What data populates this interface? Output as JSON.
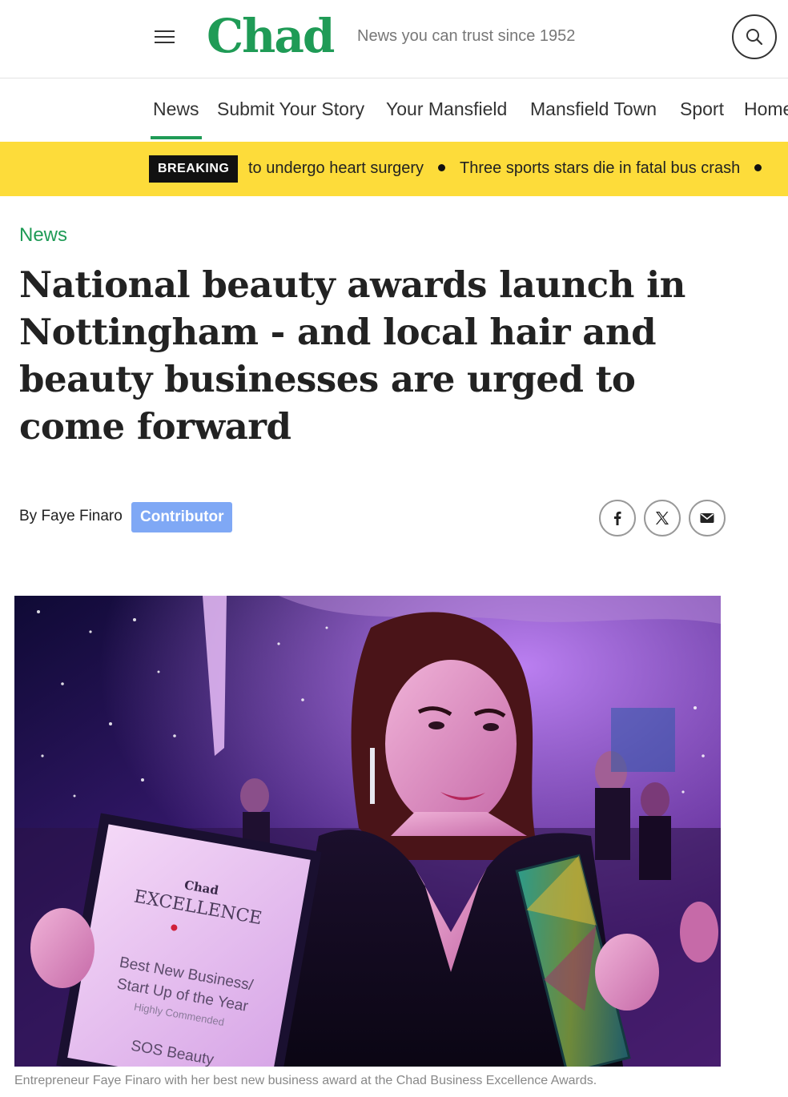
{
  "header": {
    "logo": "Chad",
    "tagline": "News you can trust since 1952"
  },
  "nav": {
    "items": [
      {
        "label": "News"
      },
      {
        "label": "Submit Your Story"
      },
      {
        "label": "Your Mansfield"
      },
      {
        "label": "Mansfield Town"
      },
      {
        "label": "Sport"
      },
      {
        "label": "Home"
      }
    ]
  },
  "breaking": {
    "badge": "BREAKING",
    "items": [
      "to undergo heart surgery",
      "Three sports stars die in fatal bus crash"
    ]
  },
  "article": {
    "section": "News",
    "headline": "National beauty awards launch in Nottingham - and local hair and beauty businesses are urged to come forward",
    "byline_prefix": "By ",
    "author": "Faye Finaro",
    "author_badge": "Contributor",
    "caption": "Entrepreneur Faye Finaro with her best new business award at the Chad Business Excellence Awards."
  },
  "image": {
    "certificate_title": "EXCELLENCE",
    "certificate_logo": "Chad",
    "certificate_text": [
      "Best New Business/",
      "Start Up of the Year",
      "Highly Commended",
      "SOS Beauty"
    ]
  },
  "colors": {
    "brand": "#1f9b56",
    "breaking_bar": "#fddc3a",
    "badge": "#7fa8f5"
  },
  "icons": {
    "menu": "hamburger-menu-icon",
    "search": "search-icon",
    "facebook": "facebook-icon",
    "x": "x-icon",
    "email": "email-icon"
  }
}
